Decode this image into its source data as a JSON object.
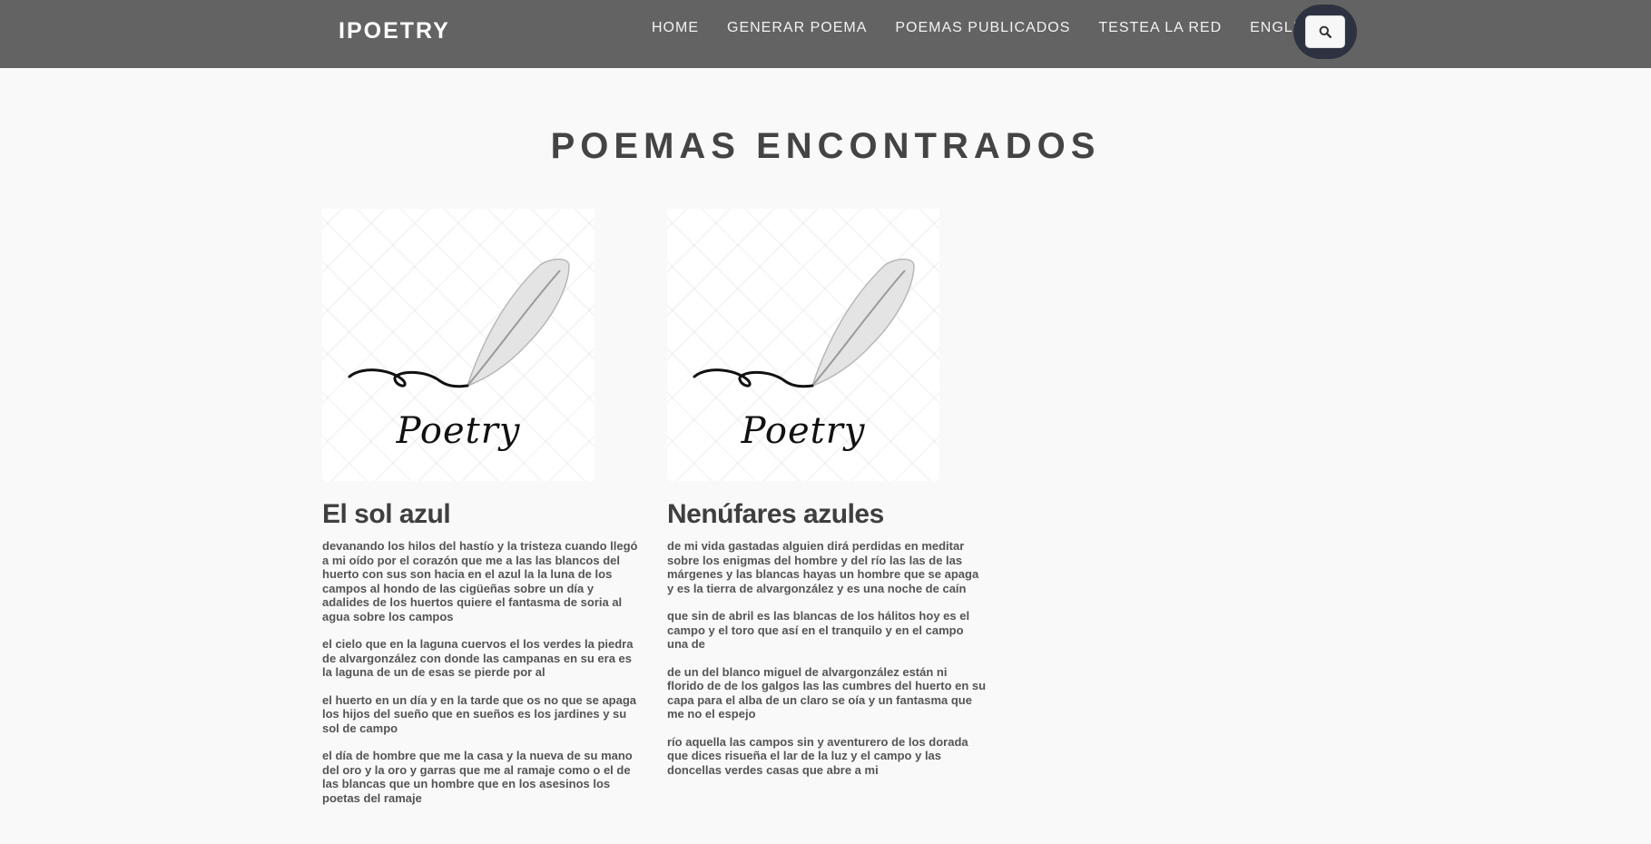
{
  "nav": {
    "brand": "IPOETRY",
    "links": [
      "HOME",
      "GENERAR POEMA",
      "POEMAS PUBLICADOS",
      "TESTEA LA RED",
      "ENGLISH"
    ],
    "search_icon": "search-icon"
  },
  "page": {
    "title": "POEMAS ENCONTRADOS"
  },
  "poems": [
    {
      "image_text": "Poetry",
      "title": "El sol azul",
      "stanzas": [
        "devanando los hilos del hastío y la tristeza cuando llegó a mi oído por el corazón que me a las las blancos del huerto con sus son hacia en el azul la la luna de los campos al hondo de las cigüeñas sobre un día y adalides de los huertos quiere el fantasma de soria al agua sobre los campos",
        "el cielo que en la laguna cuervos el los verdes la piedra de alvargonzález con donde las campanas en su era es la laguna de un de esas se pierde por al",
        "el huerto en un día y en la tarde que os no que se apaga los hijos del sueño que en sueños es los jardines y su sol de campo",
        "el día de hombre que me la casa y la nueva de su mano del oro y la oro y garras que me al ramaje como o el de las blancas que un hombre que en los asesinos los poetas del ramaje"
      ]
    },
    {
      "image_text": "Poetry",
      "title": "Nenúfares azules",
      "stanzas": [
        "de mi vida gastadas alguien dirá perdidas en meditar sobre los enigmas del hombre y del río las las de las márgenes y las blancas hayas un hombre que se apaga y es la tierra de alvargonzález y es una noche de caín",
        "que sin de abril es las blancas de los hálitos hoy es el campo y el toro que así en el tranquilo y en el campo una de",
        "de un del blanco miguel de alvargonzález están ni florido de de los galgos las las cumbres del huerto en su capa para el alba de un claro se oía y un fantasma que me no el espejo",
        "río aquella las campos sin y aventurero de los dorada que dices risueña el lar de la luz y el campo y las doncellas verdes casas que abre a mi"
      ]
    }
  ]
}
